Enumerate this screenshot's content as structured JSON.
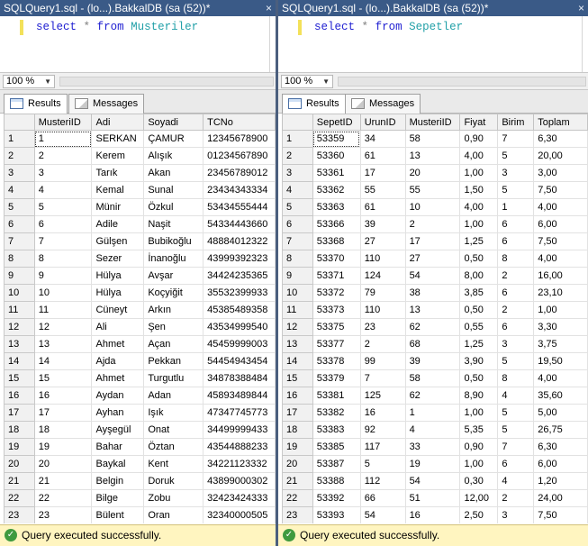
{
  "left": {
    "title": "SQLQuery1.sql - (lo...).BakkalDB (sa (52))*",
    "query": {
      "keyword_select": "select",
      "star": "*",
      "keyword_from": "from",
      "table": "Musteriler"
    },
    "zoom": "100 %",
    "tabs": {
      "results": "Results",
      "messages": "Messages"
    },
    "columns": [
      "MusteriID",
      "Adi",
      "Soyadi",
      "TCNo"
    ],
    "rows": [
      [
        "1",
        "1",
        "SERKAN",
        "ÇAMUR",
        "12345678900"
      ],
      [
        "2",
        "2",
        "Kerem",
        "Alışık",
        "01234567890"
      ],
      [
        "3",
        "3",
        "Tarık",
        "Akan",
        "23456789012"
      ],
      [
        "4",
        "4",
        "Kemal",
        "Sunal",
        "23434343334"
      ],
      [
        "5",
        "5",
        "Münir",
        "Özkul",
        "53434555444"
      ],
      [
        "6",
        "6",
        "Adile",
        "Naşit",
        "54334443660"
      ],
      [
        "7",
        "7",
        "Gülşen",
        "Bubikoğlu",
        "48884012322"
      ],
      [
        "8",
        "8",
        "Sezer",
        "İnanoğlu",
        "43999392323"
      ],
      [
        "9",
        "9",
        "Hülya",
        "Avşar",
        "34424235365"
      ],
      [
        "10",
        "10",
        "Hülya",
        "Koçyiğit",
        "35532399933"
      ],
      [
        "11",
        "11",
        "Cüneyt",
        "Arkın",
        "45385489358"
      ],
      [
        "12",
        "12",
        "Ali",
        "Şen",
        "43534999540"
      ],
      [
        "13",
        "13",
        "Ahmet",
        "Açan",
        "45459999003"
      ],
      [
        "14",
        "14",
        "Ajda",
        "Pekkan",
        "54454943454"
      ],
      [
        "15",
        "15",
        "Ahmet",
        "Turgutlu",
        "34878388484"
      ],
      [
        "16",
        "16",
        "Aydan",
        "Adan",
        "45893489844"
      ],
      [
        "17",
        "17",
        "Ayhan",
        "Işık",
        "47347745773"
      ],
      [
        "18",
        "18",
        "Ayşegül",
        "Onat",
        "34499999433"
      ],
      [
        "19",
        "19",
        "Bahar",
        "Öztan",
        "43544888233"
      ],
      [
        "20",
        "20",
        "Baykal",
        "Kent",
        "34221123332"
      ],
      [
        "21",
        "21",
        "Belgin",
        "Doruk",
        "43899000302"
      ],
      [
        "22",
        "22",
        "Bilge",
        "Zobu",
        "32423424333"
      ],
      [
        "23",
        "23",
        "Bülent",
        "Oran",
        "32340000505"
      ]
    ],
    "status": "Query executed successfully."
  },
  "right": {
    "title": "SQLQuery1.sql - (lo...).BakkalDB (sa (52))*",
    "query": {
      "keyword_select": "select",
      "star": "*",
      "keyword_from": "from",
      "table": "Sepetler"
    },
    "zoom": "100 %",
    "tabs": {
      "results": "Results",
      "messages": "Messages"
    },
    "columns": [
      "SepetID",
      "UrunID",
      "MusteriID",
      "Fiyat",
      "Birim",
      "Toplam"
    ],
    "rows": [
      [
        "1",
        "53359",
        "34",
        "58",
        "0,90",
        "7",
        "6,30"
      ],
      [
        "2",
        "53360",
        "61",
        "13",
        "4,00",
        "5",
        "20,00"
      ],
      [
        "3",
        "53361",
        "17",
        "20",
        "1,00",
        "3",
        "3,00"
      ],
      [
        "4",
        "53362",
        "55",
        "55",
        "1,50",
        "5",
        "7,50"
      ],
      [
        "5",
        "53363",
        "61",
        "10",
        "4,00",
        "1",
        "4,00"
      ],
      [
        "6",
        "53366",
        "39",
        "2",
        "1,00",
        "6",
        "6,00"
      ],
      [
        "7",
        "53368",
        "27",
        "17",
        "1,25",
        "6",
        "7,50"
      ],
      [
        "8",
        "53370",
        "110",
        "27",
        "0,50",
        "8",
        "4,00"
      ],
      [
        "9",
        "53371",
        "124",
        "54",
        "8,00",
        "2",
        "16,00"
      ],
      [
        "10",
        "53372",
        "79",
        "38",
        "3,85",
        "6",
        "23,10"
      ],
      [
        "11",
        "53373",
        "110",
        "13",
        "0,50",
        "2",
        "1,00"
      ],
      [
        "12",
        "53375",
        "23",
        "62",
        "0,55",
        "6",
        "3,30"
      ],
      [
        "13",
        "53377",
        "2",
        "68",
        "1,25",
        "3",
        "3,75"
      ],
      [
        "14",
        "53378",
        "99",
        "39",
        "3,90",
        "5",
        "19,50"
      ],
      [
        "15",
        "53379",
        "7",
        "58",
        "0,50",
        "8",
        "4,00"
      ],
      [
        "16",
        "53381",
        "125",
        "62",
        "8,90",
        "4",
        "35,60"
      ],
      [
        "17",
        "53382",
        "16",
        "1",
        "1,00",
        "5",
        "5,00"
      ],
      [
        "18",
        "53383",
        "92",
        "4",
        "5,35",
        "5",
        "26,75"
      ],
      [
        "19",
        "53385",
        "117",
        "33",
        "0,90",
        "7",
        "6,30"
      ],
      [
        "20",
        "53387",
        "5",
        "19",
        "1,00",
        "6",
        "6,00"
      ],
      [
        "21",
        "53388",
        "112",
        "54",
        "0,30",
        "4",
        "1,20"
      ],
      [
        "22",
        "53392",
        "66",
        "51",
        "12,00",
        "2",
        "24,00"
      ],
      [
        "23",
        "53393",
        "54",
        "16",
        "2,50",
        "3",
        "7,50"
      ]
    ],
    "status": "Query executed successfully."
  }
}
